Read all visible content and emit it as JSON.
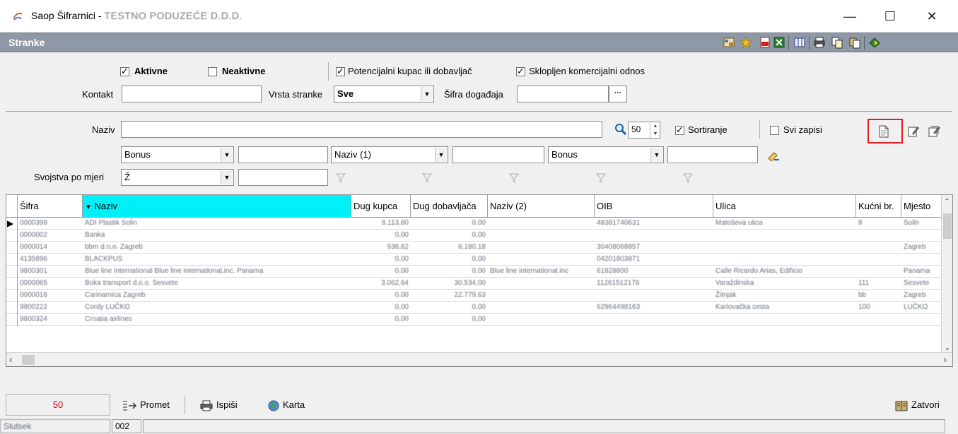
{
  "window": {
    "title": "Saop Šifrarnici - ",
    "company": "TESTNO PODUZEĆE D.D.D.",
    "minimize": "—",
    "maximize": "☐",
    "close": "✕"
  },
  "section": {
    "title": "Stranke"
  },
  "filters": {
    "aktivne_label": "Aktivne",
    "aktivne_checked": true,
    "neaktivne_label": "Neaktivne",
    "neaktivne_checked": false,
    "potencijalni_label": "Potencijalni kupac ili dobavljač",
    "potencijalni_checked": true,
    "sklopljen_label": "Sklopljen komercijalni odnos",
    "sklopljen_checked": true,
    "kontakt_label": "Kontakt",
    "kontakt_value": "",
    "vrsta_label": "Vrsta stranke",
    "vrsta_value": "Sve",
    "sifra_dogadaja_label": "Šifra događaja",
    "sifra_dogadaja_value": "",
    "ellipsis": "···"
  },
  "search": {
    "naziv_label": "Naziv",
    "naziv_value": "",
    "count_value": "50",
    "sortiranje_label": "Sortiranje",
    "sortiranje_checked": true,
    "svi_zapisi_label": "Svi zapisi",
    "svi_zapisi_checked": false,
    "combo1": "Bonus",
    "combo2": "Naziv (1)",
    "combo3": "Bonus",
    "svojstva_label": "Svojstva po mjeri",
    "svojstva_value": "Ž"
  },
  "grid": {
    "columns": [
      "Šifra",
      "Naziv",
      "Dug kupca",
      "Dug dobavljača",
      "Naziv (2)",
      "OIB",
      "Ulica",
      "Kućni br.",
      "Mjesto"
    ],
    "sort_marker": "▼",
    "rows": [
      [
        "0000399",
        "ADI Plastik Solin",
        "8.113,80",
        "0,00",
        "",
        "48381740631",
        "Matoševa ulica",
        "8",
        "Solin"
      ],
      [
        "0000002",
        "Banka",
        "0,00",
        "0,00",
        "",
        "",
        "",
        "",
        ""
      ],
      [
        "0000014",
        "bbm d.o.o. Zagreb",
        "938,82",
        "6.180,18",
        "",
        "30408068857",
        "",
        "",
        "Zagreb"
      ],
      [
        "4135896",
        "BLACKPUS",
        "0,00",
        "0,00",
        "",
        "04201803871",
        "",
        "",
        ""
      ],
      [
        "9800301",
        "Blue line international Blue line international,inc. Panama",
        "0,00",
        "0,00",
        "Blue line international,inc",
        "61828800",
        "Calle Ricardo Arias, Edificio",
        "",
        "Panama"
      ],
      [
        "0000065",
        "Boka transport d.o.o. Sesvete",
        "3.062,64",
        "30.534,00",
        "",
        "11261512176",
        "Varaždinska",
        "111",
        "Sesvete"
      ],
      [
        "0000018",
        "Carinarnica Zagreb",
        "0,00",
        "22.779,63",
        "",
        "",
        "Žitnjak",
        "bb",
        "Zagreb"
      ],
      [
        "9800222",
        "Cordy LUČKO",
        "0,00",
        "0,00",
        "",
        "62964498163",
        "Karlovačka cesta",
        "100",
        "LUČKO"
      ],
      [
        "9800324",
        "Croatia airlines",
        "0,00",
        "0,00",
        "",
        "",
        "",
        "",
        ""
      ]
    ]
  },
  "bottom": {
    "count": "50",
    "promet": "Promet",
    "ispisi": "Ispiši",
    "karta": "Karta",
    "zatvori": "Zatvori"
  },
  "status": {
    "user": "Slutsek",
    "code": "002"
  }
}
